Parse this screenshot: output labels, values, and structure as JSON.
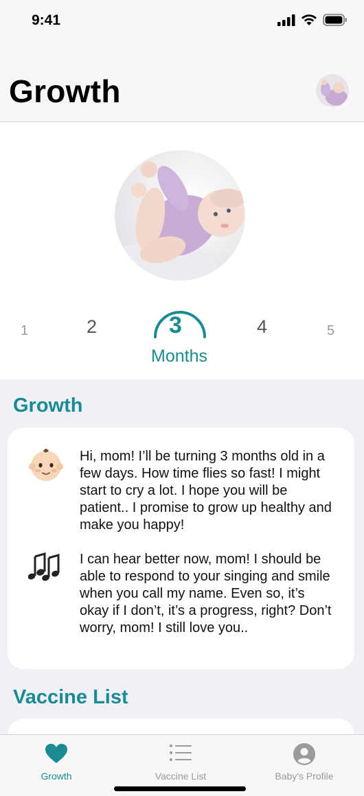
{
  "status_bar": {
    "time": "9:41"
  },
  "header": {
    "title": "Growth"
  },
  "month_picker": {
    "months": [
      "1",
      "2",
      "3",
      "4",
      "5"
    ],
    "selected": "3",
    "unit_label": "Months"
  },
  "growth_section": {
    "title": "Growth",
    "notes": [
      {
        "icon": "baby-face-icon",
        "text": "Hi, mom! I’ll be turning 3 months old in a few days. How time flies so fast! I might start to cry a lot. I hope you will be patient.. I promise to grow up healthy and make you happy!"
      },
      {
        "icon": "musical-notes-icon",
        "text": "I can hear better now, mom! I should be able to respond to your singing and smile when you call my name. Even so, it’s okay if I don’t, it’s a progress, right? Don’t worry, mom! I still love you.."
      }
    ]
  },
  "vaccine_section": {
    "title": "Vaccine List"
  },
  "tab_bar": {
    "tabs": [
      {
        "label": "Growth",
        "icon": "heart-icon",
        "active": true
      },
      {
        "label": "Vaccine List",
        "icon": "list-icon",
        "active": false
      },
      {
        "label": "Baby's Profile",
        "icon": "profile-icon",
        "active": false
      }
    ]
  },
  "colors": {
    "accent": "#1a8a93",
    "background": "#f0f1f6",
    "card": "#ffffff"
  }
}
